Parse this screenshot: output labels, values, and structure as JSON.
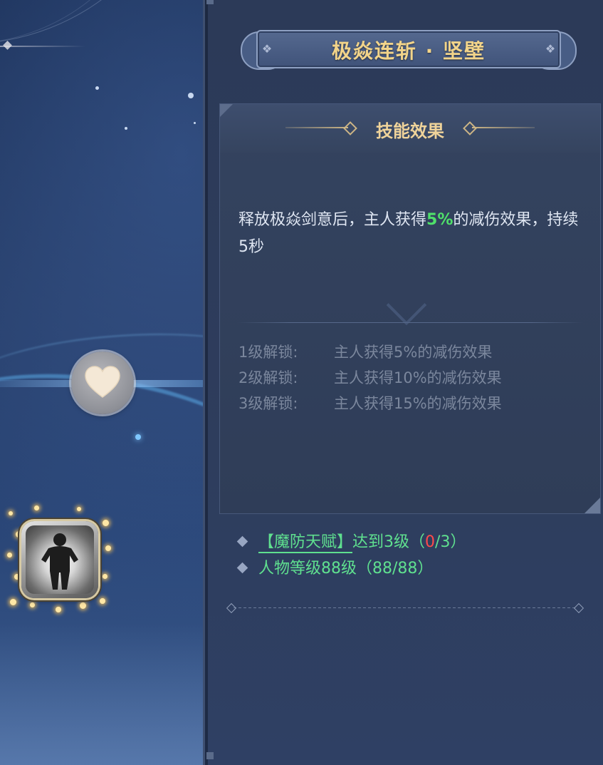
{
  "skill": {
    "title": "极焱连斩 · 坚壁",
    "effect_header": "技能效果",
    "description_prefix": "释放极焱剑意后，主人获得",
    "description_value": "5%",
    "description_suffix": "的减伤效果，持续5秒",
    "levels": [
      {
        "label": "1级解锁:",
        "text": "主人获得5%的减伤效果"
      },
      {
        "label": "2级解锁:",
        "text": "主人获得10%的减伤效果"
      },
      {
        "label": "3级解锁:",
        "text": "主人获得15%的减伤效果"
      }
    ]
  },
  "requirements": {
    "talent": {
      "link_text": "【魔防天赋】",
      "after_link": "达到3级",
      "open": "（",
      "current": "0",
      "slash_total": "/3",
      "close": "）"
    },
    "level": {
      "text": "人物等级88级（88/88）"
    }
  },
  "icons": {
    "node": "heart-icon",
    "skill_slot": "character-silhouette-icon"
  },
  "colors": {
    "title_gold": "#f2d48a",
    "highlight_green": "#4fe06a",
    "requirement_green": "#5fe08f",
    "fail_red": "#ff4a4a",
    "locked_text": "#7b879d"
  }
}
